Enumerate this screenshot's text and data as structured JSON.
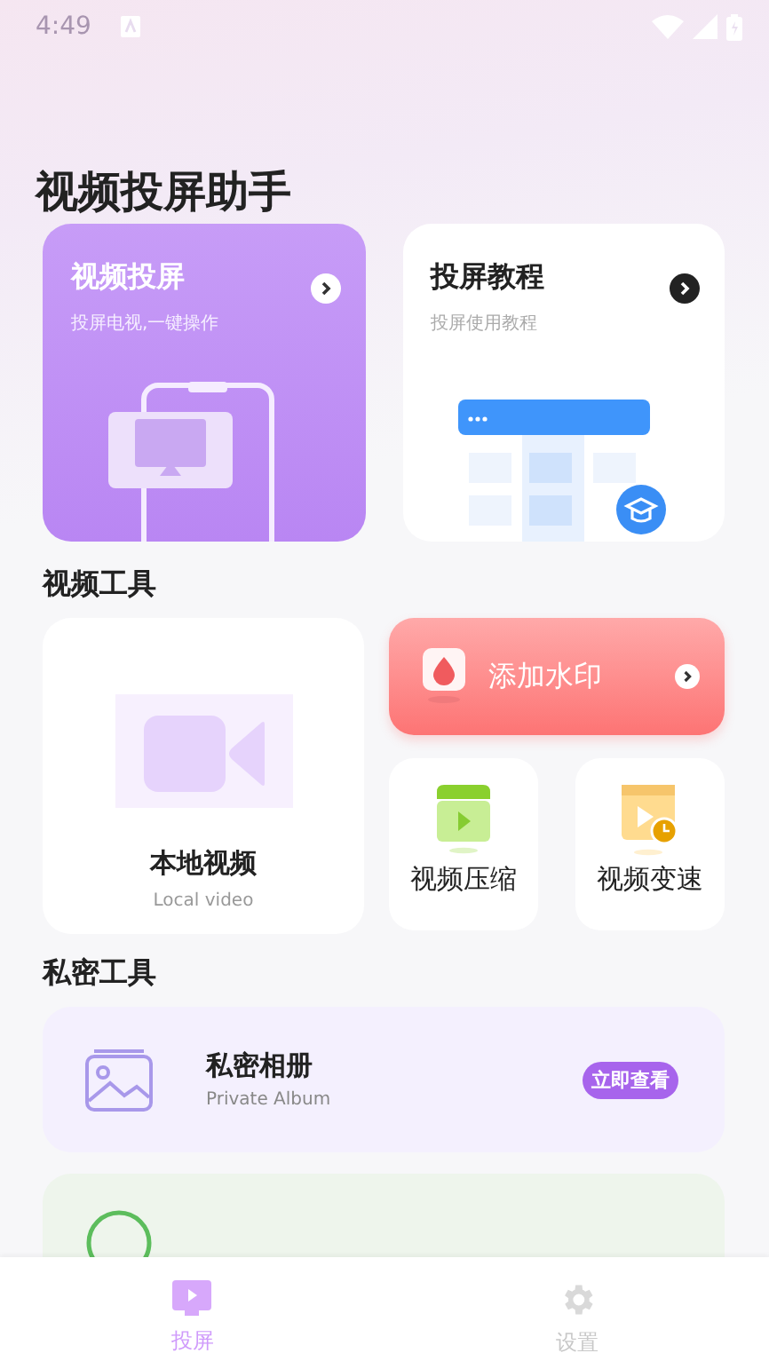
{
  "status_bar": {
    "time": "4:49"
  },
  "title": "视频投屏助手",
  "cast_cards": [
    {
      "kind": "cast",
      "title": "视频投屏",
      "subtitle": "投屏电视,一键操作"
    },
    {
      "kind": "tutorial",
      "title": "投屏教程",
      "subtitle": "投屏使用教程"
    }
  ],
  "video_tools": {
    "heading": "视频工具",
    "local": {
      "title": "本地视频",
      "subtitle": "Local video"
    },
    "watermark": {
      "title": "添加水印"
    },
    "small": [
      {
        "kind": "compress",
        "title": "视频压缩"
      },
      {
        "kind": "speed",
        "title": "视频变速"
      }
    ]
  },
  "private_tools": {
    "heading": "私密工具",
    "items": [
      {
        "kind": "album",
        "title": "私密相册",
        "subtitle": "Private Album",
        "button": "立即查看"
      },
      {
        "kind": "video"
      }
    ]
  },
  "tabs": [
    {
      "kind": "cast",
      "label": "投屏",
      "selected": true
    },
    {
      "kind": "settings",
      "label": "设置",
      "selected": false
    }
  ]
}
